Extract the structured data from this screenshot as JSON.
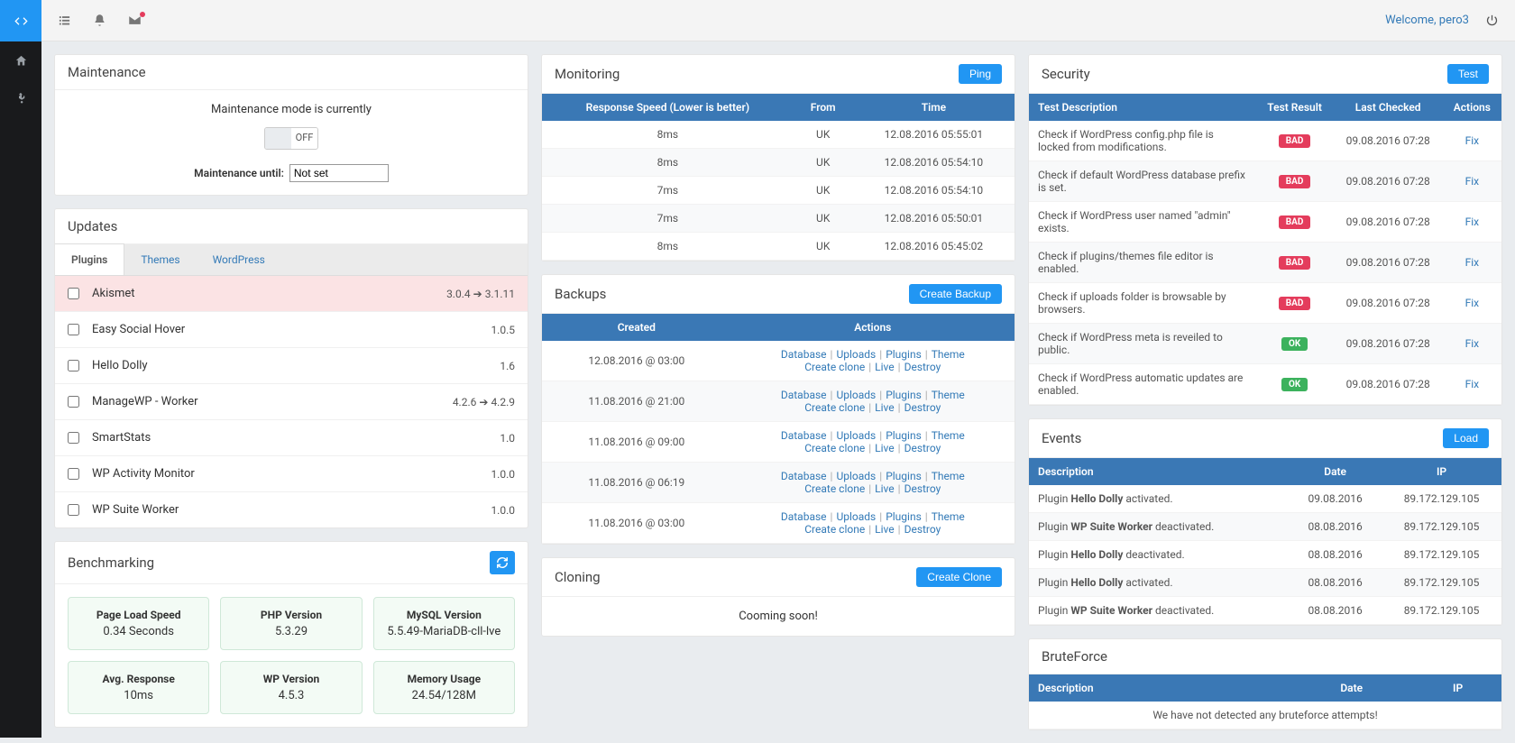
{
  "header": {
    "welcome": "Welcome, pero3"
  },
  "maintenance": {
    "title": "Maintenance",
    "status_text": "Maintenance mode is currently",
    "toggle": "OFF",
    "until_label": "Maintenance until:",
    "until_value": "Not set"
  },
  "updates": {
    "title": "Updates",
    "tabs": [
      "Plugins",
      "Themes",
      "WordPress"
    ],
    "plugins": [
      {
        "name": "Akismet",
        "from": "3.0.4",
        "to": "3.1.11",
        "highlight": true
      },
      {
        "name": "Easy Social Hover",
        "ver": "1.0.5"
      },
      {
        "name": "Hello Dolly",
        "ver": "1.6"
      },
      {
        "name": "ManageWP - Worker",
        "from": "4.2.6",
        "to": "4.2.9"
      },
      {
        "name": "SmartStats",
        "ver": "1.0"
      },
      {
        "name": "WP Activity Monitor",
        "ver": "1.0.0"
      },
      {
        "name": "WP Suite Worker",
        "ver": "1.0.0"
      }
    ]
  },
  "benchmarking": {
    "title": "Benchmarking",
    "cards": [
      {
        "t": "Page Load Speed",
        "v": "0.34 Seconds"
      },
      {
        "t": "PHP Version",
        "v": "5.3.29"
      },
      {
        "t": "MySQL Version",
        "v": "5.5.49-MariaDB-cll-lve"
      },
      {
        "t": "Avg. Response",
        "v": "10ms"
      },
      {
        "t": "WP Version",
        "v": "4.5.3"
      },
      {
        "t": "Memory Usage",
        "v": "24.54/128M"
      }
    ]
  },
  "monitoring": {
    "title": "Monitoring",
    "button": "Ping",
    "headers": [
      "Response Speed (Lower is better)",
      "From",
      "Time"
    ],
    "rows": [
      {
        "speed": "8ms",
        "from": "UK",
        "time": "12.08.2016 05:55:01"
      },
      {
        "speed": "8ms",
        "from": "UK",
        "time": "12.08.2016 05:54:10"
      },
      {
        "speed": "7ms",
        "from": "UK",
        "time": "12.08.2016 05:54:10"
      },
      {
        "speed": "7ms",
        "from": "UK",
        "time": "12.08.2016 05:50:01"
      },
      {
        "speed": "8ms",
        "from": "UK",
        "time": "12.08.2016 05:45:02"
      }
    ]
  },
  "backups": {
    "title": "Backups",
    "button": "Create Backup",
    "headers": [
      "Created",
      "Actions"
    ],
    "action_links": [
      "Database",
      "Uploads",
      "Plugins",
      "Theme"
    ],
    "action_links2": [
      "Create clone",
      "Live",
      "Destroy"
    ],
    "rows": [
      "12.08.2016 @ 03:00",
      "11.08.2016 @ 21:00",
      "11.08.2016 @ 09:00",
      "11.08.2016 @ 06:19",
      "11.08.2016 @ 03:00"
    ]
  },
  "cloning": {
    "title": "Cloning",
    "button": "Create Clone",
    "body": "Cooming soon!"
  },
  "security": {
    "title": "Security",
    "button": "Test",
    "headers": [
      "Test Description",
      "Test Result",
      "Last Checked",
      "Actions"
    ],
    "fix": "Fix",
    "rows": [
      {
        "desc": "Check if WordPress config.php file is locked from modifications.",
        "result": "BAD",
        "time": "09.08.2016 07:28"
      },
      {
        "desc": "Check if default WordPress database prefix is set.",
        "result": "BAD",
        "time": "09.08.2016 07:28"
      },
      {
        "desc": "Check if WordPress user named \"admin\" exists.",
        "result": "BAD",
        "time": "09.08.2016 07:28"
      },
      {
        "desc": "Check if plugins/themes file editor is enabled.",
        "result": "BAD",
        "time": "09.08.2016 07:28"
      },
      {
        "desc": "Check if uploads folder is browsable by browsers.",
        "result": "BAD",
        "time": "09.08.2016 07:28"
      },
      {
        "desc": "Check if WordPress meta is reveiled to public.",
        "result": "OK",
        "time": "09.08.2016 07:28"
      },
      {
        "desc": "Check if WordPress automatic updates are enabled.",
        "result": "OK",
        "time": "09.08.2016 07:28"
      }
    ]
  },
  "events": {
    "title": "Events",
    "button": "Load",
    "headers": [
      "Description",
      "Date",
      "IP"
    ],
    "rows": [
      {
        "pre": "Plugin ",
        "b": "Hello Dolly",
        "post": " activated.",
        "date": "09.08.2016",
        "ip": "89.172.129.105"
      },
      {
        "pre": "Plugin ",
        "b": "WP Suite Worker",
        "post": " deactivated.",
        "date": "08.08.2016",
        "ip": "89.172.129.105"
      },
      {
        "pre": "Plugin ",
        "b": "Hello Dolly",
        "post": " deactivated.",
        "date": "08.08.2016",
        "ip": "89.172.129.105"
      },
      {
        "pre": "Plugin ",
        "b": "Hello Dolly",
        "post": " activated.",
        "date": "08.08.2016",
        "ip": "89.172.129.105"
      },
      {
        "pre": "Plugin ",
        "b": "WP Suite Worker",
        "post": " deactivated.",
        "date": "08.08.2016",
        "ip": "89.172.129.105"
      }
    ]
  },
  "bruteforce": {
    "title": "BruteForce",
    "headers": [
      "Description",
      "Date",
      "IP"
    ],
    "empty": "We have not detected any bruteforce attempts!"
  }
}
